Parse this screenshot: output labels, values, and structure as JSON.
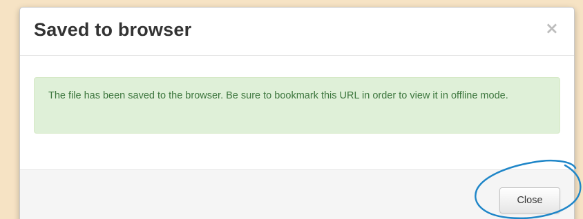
{
  "dialog": {
    "title": "Saved to browser",
    "close_glyph": "×",
    "message": "The file has been saved to the browser. Be sure to bookmark this URL in order to view it in offline mode.",
    "close_button_label": "Close"
  },
  "colors": {
    "page_background": "#f6e3c4",
    "alert_background": "#dff0d8",
    "alert_text": "#3c763d",
    "footer_background": "#f5f5f5",
    "annotation_circle": "#1f86c8"
  },
  "icons": {
    "dismiss": "close-icon",
    "highlight": "annotation-circle-icon"
  }
}
